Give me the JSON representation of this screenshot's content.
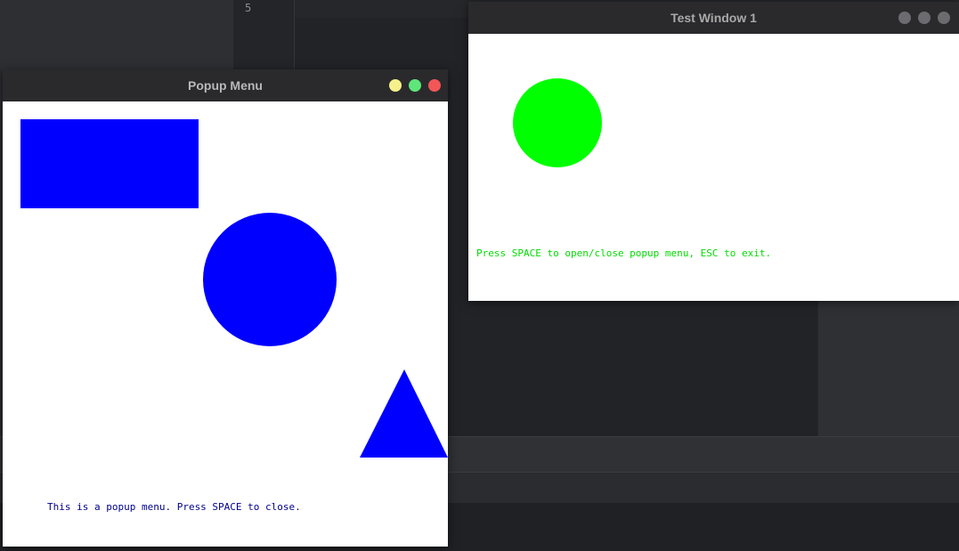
{
  "editor": {
    "line_number": "5"
  },
  "popup_window": {
    "title": "Popup Menu",
    "title_color": "#b8b8b8",
    "controls": [
      {
        "name": "minimize",
        "color": "#f5f08a"
      },
      {
        "name": "maximize",
        "color": "#5ee67a"
      },
      {
        "name": "close",
        "color": "#f25656"
      }
    ],
    "message": "This is a popup menu. Press SPACE to close.",
    "message_color": "#00008b",
    "shape_color": "#0000ff"
  },
  "test_window": {
    "title": "Test Window 1",
    "title_color": "#a9a9a9",
    "controls": [
      {
        "name": "minimize",
        "color": "#6b6b70"
      },
      {
        "name": "maximize",
        "color": "#6b6b70"
      },
      {
        "name": "close",
        "color": "#6b6b70"
      }
    ],
    "message": "Press SPACE to open/close popup menu, ESC to exit.",
    "message_color": "#00dd00",
    "shape_color": "#00ff00"
  }
}
